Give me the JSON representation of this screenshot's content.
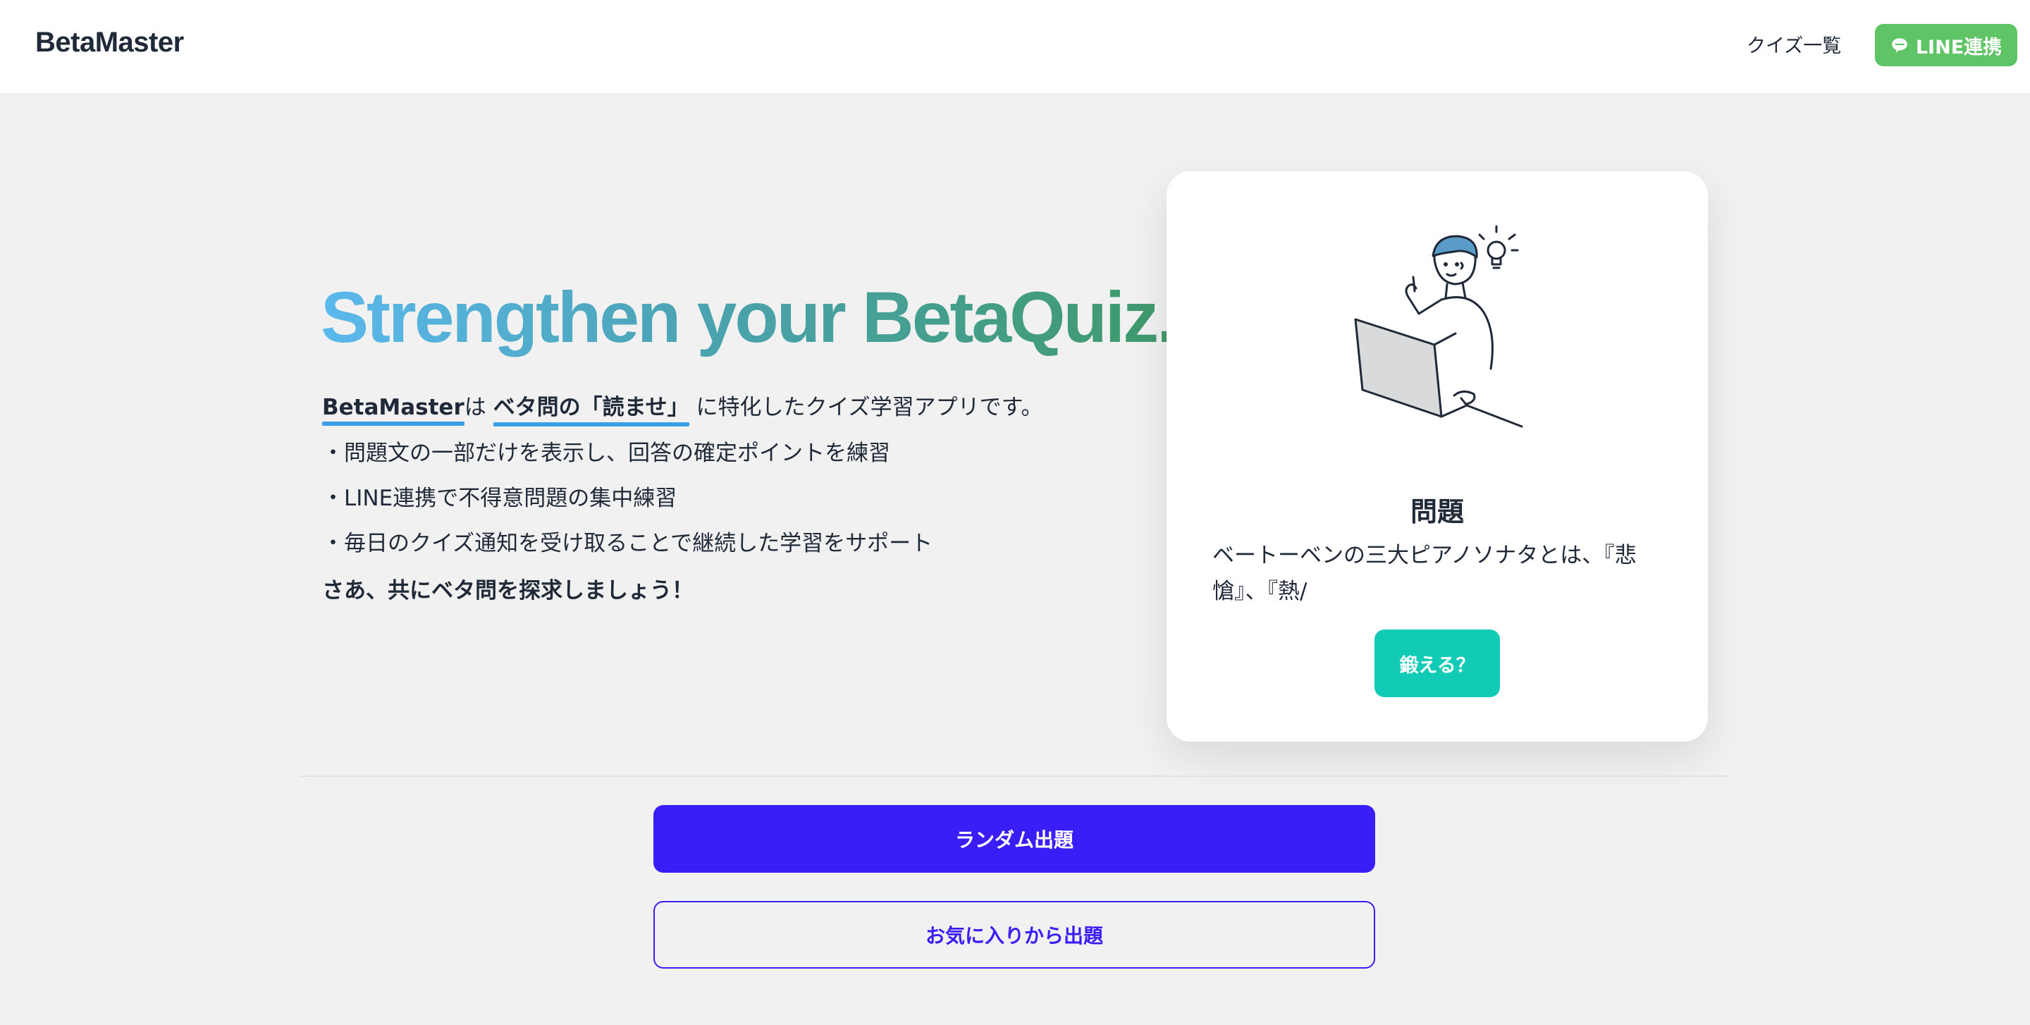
{
  "header": {
    "brand": "BetaMaster",
    "nav_quiz_list": "クイズ一覧",
    "line_button": "LINE連携"
  },
  "hero": {
    "title": "Strengthen your BetaQuiz.",
    "intro": {
      "brand": "BetaMaster",
      "particle": "は",
      "keyword": "ベタ問の「読ませ」",
      "rest": "に特化したクイズ学習アプリです。"
    },
    "bullets": [
      "・問題文の一部だけを表示し、回答の確定ポイントを練習",
      "・LINE連携で不得意問題の集中練習",
      "・毎日のクイズ通知を受け取ることで継続した学習をサポート"
    ],
    "closing": "さあ、共にベタ問を探求しましょう！"
  },
  "quiz_card": {
    "title": "問題",
    "text": "ベートーベンの三大ピアノソナタとは、『悲愴』、『熱/",
    "answer_button": "鍛える？"
  },
  "actions": {
    "random": "ランダム出題",
    "favorites": "お気に入りから出題"
  },
  "colors": {
    "line_green": "#5fc466",
    "primary_blue": "#3a1ef8",
    "teal": "#12cbb7",
    "gradient_start": "#5bb8ec",
    "gradient_end": "#3f9a6a",
    "underline_blue": "#3b9ee6"
  },
  "icons": {
    "line_button_icon": "chat-bubble-icon",
    "card_illustration": "person-with-laptop-idea-illustration"
  }
}
